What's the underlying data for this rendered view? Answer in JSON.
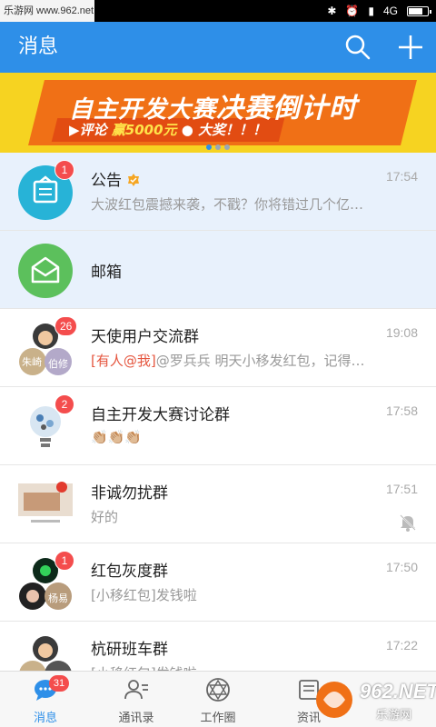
{
  "status_bar": {
    "watermark": "乐游网 www.962.net",
    "network": "4G"
  },
  "header": {
    "title": "消息",
    "search_icon": "search-icon",
    "add_icon": "plus-icon"
  },
  "banner": {
    "title_part1": "自主开发大赛",
    "title_part2": "决赛倒计时",
    "subtitle_part1": "▶评论",
    "subtitle_highlight": "赢5000元",
    "subtitle_part2": "大奖！！！",
    "page_count": 3,
    "current_page": 1
  },
  "conversations": [
    {
      "name": "公告",
      "time": "17:54",
      "preview": "大波红包震撼来袭，不戳？你将错过几个亿…",
      "badge": "1",
      "pinned": true,
      "verified": true,
      "avatar_icon": "notice-icon"
    },
    {
      "name": "邮箱",
      "time": "",
      "preview": "",
      "badge": "",
      "pinned": true,
      "avatar_icon": "mail-icon"
    },
    {
      "name": "天使用户交流群",
      "time": "19:08",
      "at_tag": "[有人@我]",
      "preview": "@罗兵兵 明天小移发红包，记得…",
      "badge": "26",
      "member_a": "朱崎",
      "member_b": "伯修"
    },
    {
      "name": "自主开发大赛讨论群",
      "time": "17:58",
      "preview": "👏🏼👏🏼👏🏼",
      "badge": "2"
    },
    {
      "name": "非诚勿扰群",
      "time": "17:51",
      "preview": "好的",
      "badge": "",
      "muted": true
    },
    {
      "name": "红包灰度群",
      "time": "17:50",
      "preview": "[小移红包]发钱啦",
      "badge": "1",
      "member_b": "杨易"
    },
    {
      "name": "杭研班车群",
      "time": "17:22",
      "preview": "[小移红包]发钱啦",
      "badge": ""
    }
  ],
  "tabs": [
    {
      "label": "消息",
      "badge": "31",
      "active": true,
      "icon": "chat-icon"
    },
    {
      "label": "通讯录",
      "icon": "contacts-icon"
    },
    {
      "label": "工作圈",
      "icon": "workcircle-icon"
    },
    {
      "label": "资讯",
      "icon": "news-icon"
    }
  ],
  "watermark_corner": {
    "brand": "962.NET",
    "sub": "乐游网"
  },
  "colors": {
    "primary": "#2e8fe8",
    "badge": "#f44d4d",
    "banner_bg": "#f6d321",
    "pinned_bg": "#e8f1fc",
    "at_tag": "#e5563f"
  }
}
